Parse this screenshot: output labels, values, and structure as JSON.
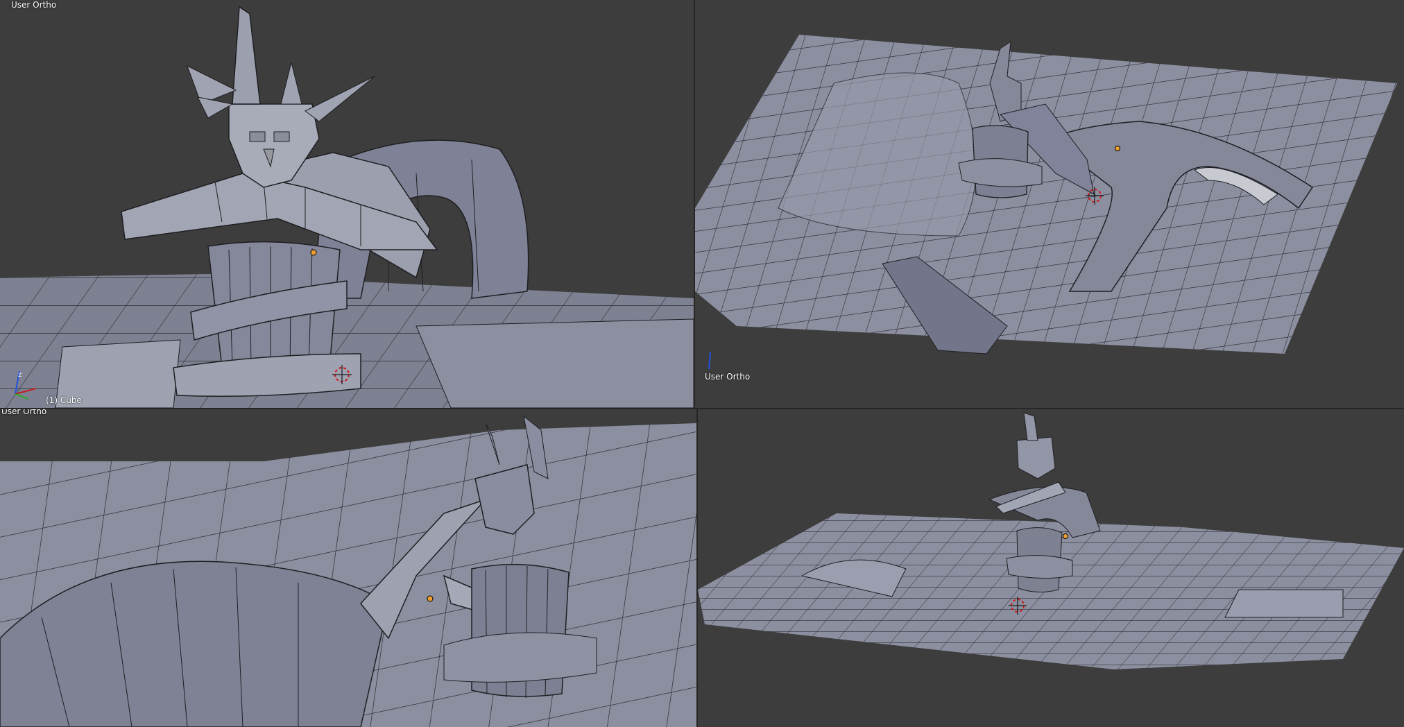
{
  "app": "Blender 3D Viewport (quad view)",
  "colors": {
    "background": "#3d3d3d",
    "mesh_face": "#8a8d9c",
    "mesh_edge": "#1e1e22",
    "origin_dot": "#f0a030",
    "cursor_red": "#d01818"
  },
  "viewports": {
    "top_left": {
      "label": "User Ortho",
      "object_info": "(1) Cube"
    },
    "top_right": {
      "label": "User Ortho"
    },
    "bottom_left": {
      "label": "User Ortho"
    },
    "bottom_right": {
      "label": ""
    }
  },
  "icons": {
    "axis_gizmo": "xyz-axis-icon",
    "cursor": "3d-cursor-icon",
    "origin": "object-origin-icon"
  }
}
